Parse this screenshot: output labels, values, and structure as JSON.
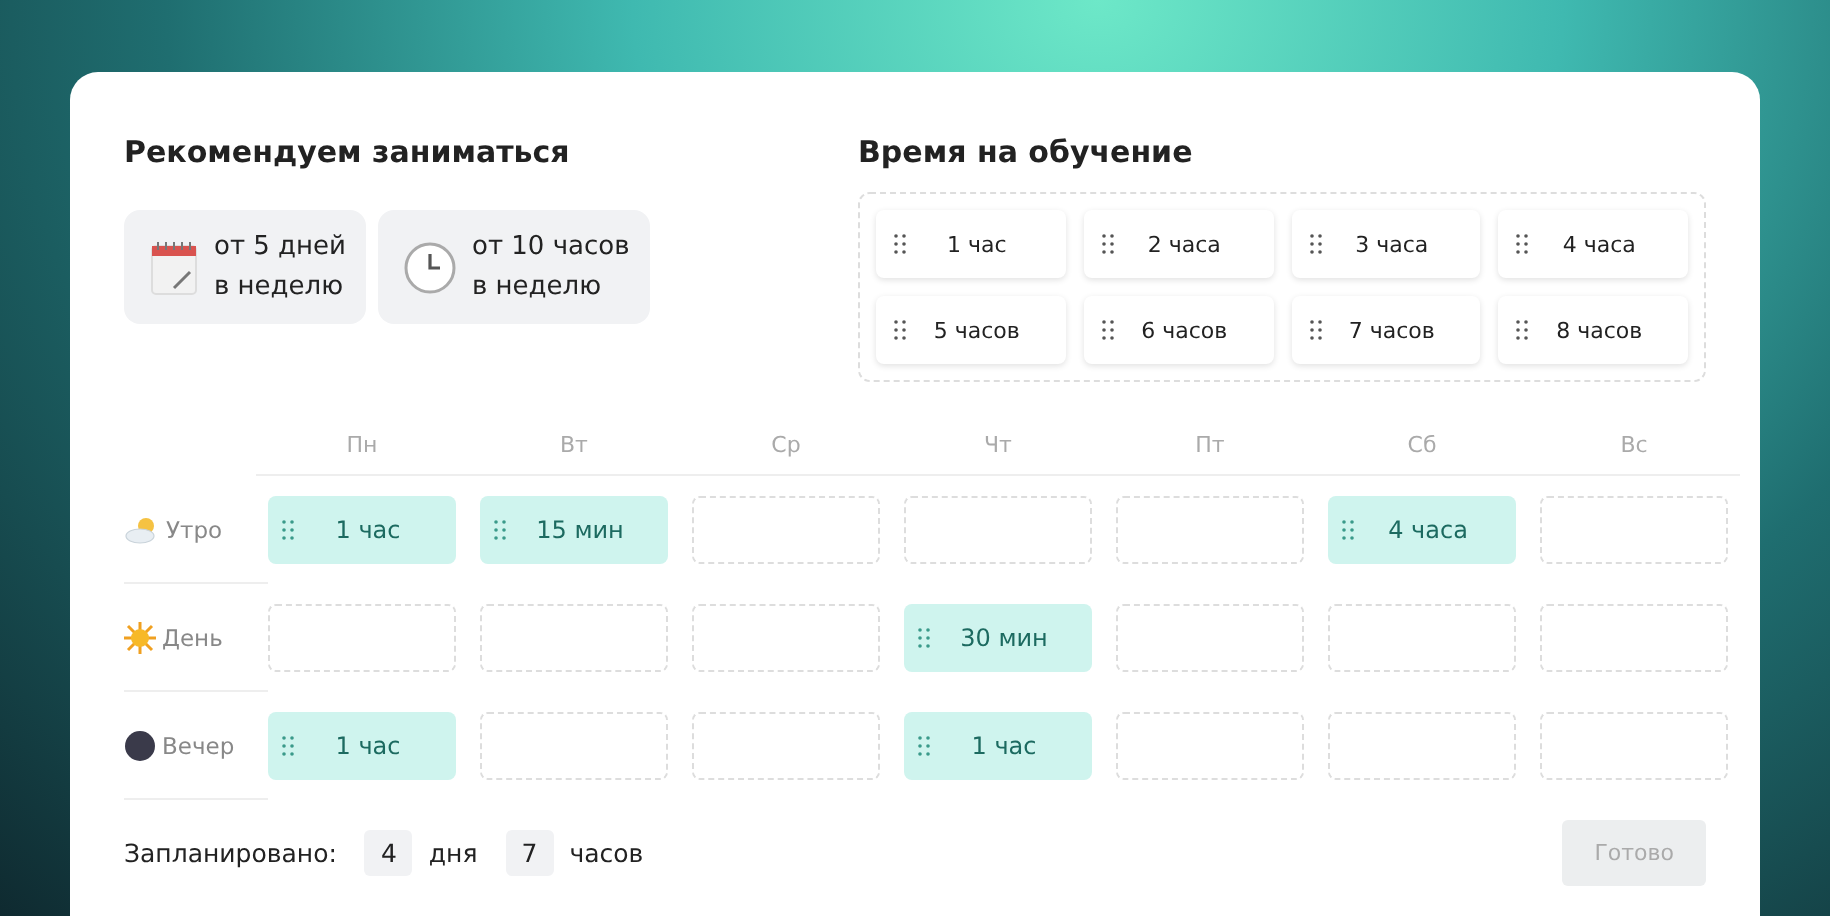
{
  "recommend": {
    "title": "Рекомендуем заниматься",
    "badges": [
      {
        "kind": "calendar",
        "line1": "от 5 дней",
        "line2": "в неделю"
      },
      {
        "kind": "clock",
        "line1": "от 10 часов",
        "line2": "в неделю"
      }
    ]
  },
  "time_pool": {
    "title": "Время на обучение",
    "chips": [
      "1 час",
      "2 часа",
      "3 часа",
      "4 часа",
      "5 часов",
      "6 часов",
      "7 часов",
      "8 часов"
    ]
  },
  "schedule": {
    "days": [
      "Пн",
      "Вт",
      "Ср",
      "Чт",
      "Пт",
      "Сб",
      "Вс"
    ],
    "rows": [
      {
        "kind": "morning",
        "label": "Утро",
        "cells": [
          {
            "filled": true,
            "text": "1 час"
          },
          {
            "filled": true,
            "text": "15 мин"
          },
          {
            "filled": false
          },
          {
            "filled": false
          },
          {
            "filled": false
          },
          {
            "filled": true,
            "text": "4 часа"
          },
          {
            "filled": false
          }
        ]
      },
      {
        "kind": "day",
        "label": "День",
        "cells": [
          {
            "filled": false
          },
          {
            "filled": false
          },
          {
            "filled": false
          },
          {
            "filled": true,
            "text": "30 мин"
          },
          {
            "filled": false
          },
          {
            "filled": false
          },
          {
            "filled": false
          }
        ]
      },
      {
        "kind": "evening",
        "label": "Вечер",
        "cells": [
          {
            "filled": true,
            "text": "1 час"
          },
          {
            "filled": false
          },
          {
            "filled": false
          },
          {
            "filled": true,
            "text": "1 час"
          },
          {
            "filled": false
          },
          {
            "filled": false
          },
          {
            "filled": false
          }
        ]
      }
    ]
  },
  "footer": {
    "label": "Запланировано:",
    "days_value": "4",
    "days_unit": "дня",
    "hours_value": "7",
    "hours_unit": "часов",
    "done_button": {
      "label": "Готово",
      "disabled": true
    }
  }
}
